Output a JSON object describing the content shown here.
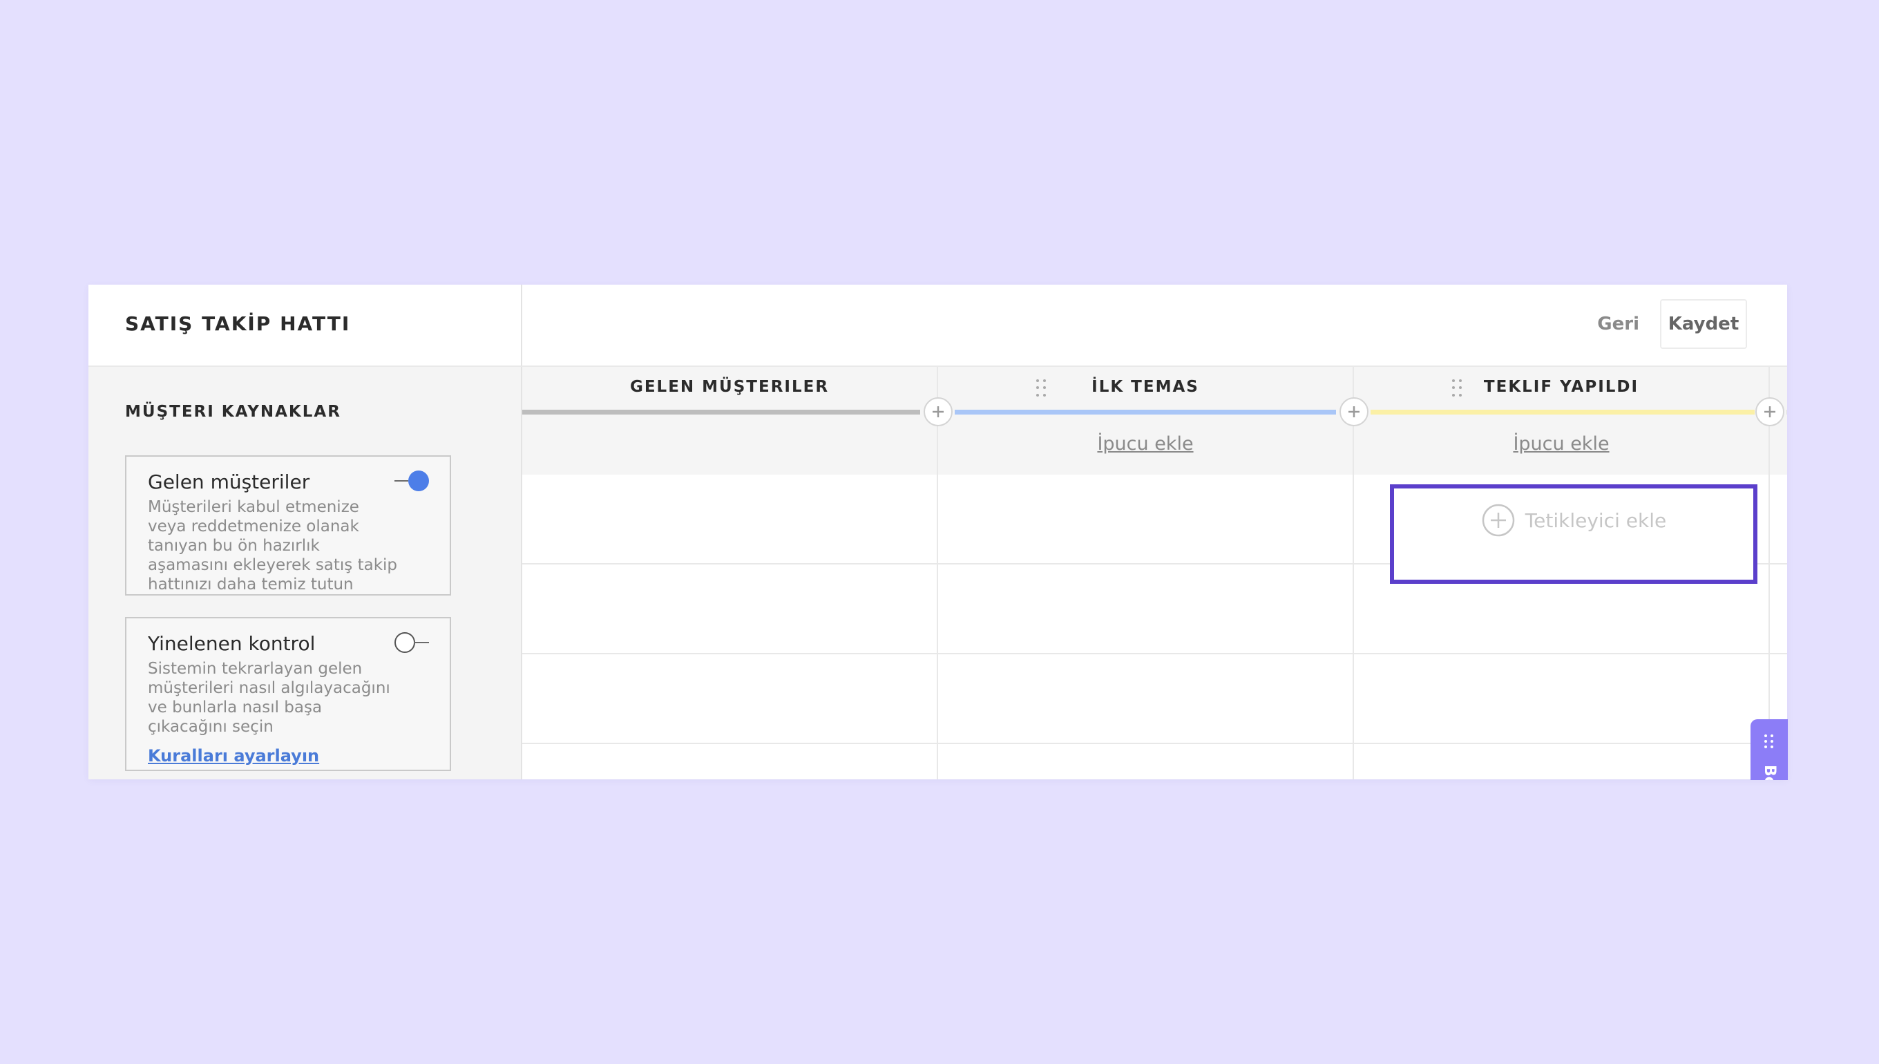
{
  "sidebar": {
    "title": "SATIŞ TAKİP HATTI",
    "section_title": "MÜŞTERI KAYNAKLAR",
    "sources": [
      {
        "title": "Gelen müşteriler",
        "description": "Müşterileri kabul etmenize veya reddetmenize olanak tanıyan bu ön hazırlık aşamasını ekleyerek satış takip hattınızı daha temiz tutun",
        "enabled": true
      },
      {
        "title": "Yinelenen kontrol",
        "description": "Sistemin tekrarlayan gelen müşterileri nasıl algılayacağını ve bunlarla nasıl başa çıkacağını seçin",
        "link": "Kuralları ayarlayın",
        "enabled": false
      }
    ]
  },
  "toolbar": {
    "back_label": "Geri",
    "save_label": "Kaydet"
  },
  "stages": [
    {
      "name": "GELEN MÜŞTERILER",
      "bar_color": "#bdbdbd",
      "hint": ""
    },
    {
      "name": "İLK TEMAS",
      "bar_color": "#a9c6f7",
      "hint": "İpucu ekle"
    },
    {
      "name": "TEKLIF YAPILDI",
      "bar_color": "#fbf0a6",
      "hint": "İpucu ekle"
    }
  ],
  "trigger": {
    "label": "Tetikleyici ekle"
  },
  "help_tab": {
    "label": "Bo"
  },
  "colors": {
    "background": "#e4e0fe",
    "accent": "#5b3fcb",
    "toggle_on": "#4d7ee8",
    "link": "#4a7bd8"
  }
}
